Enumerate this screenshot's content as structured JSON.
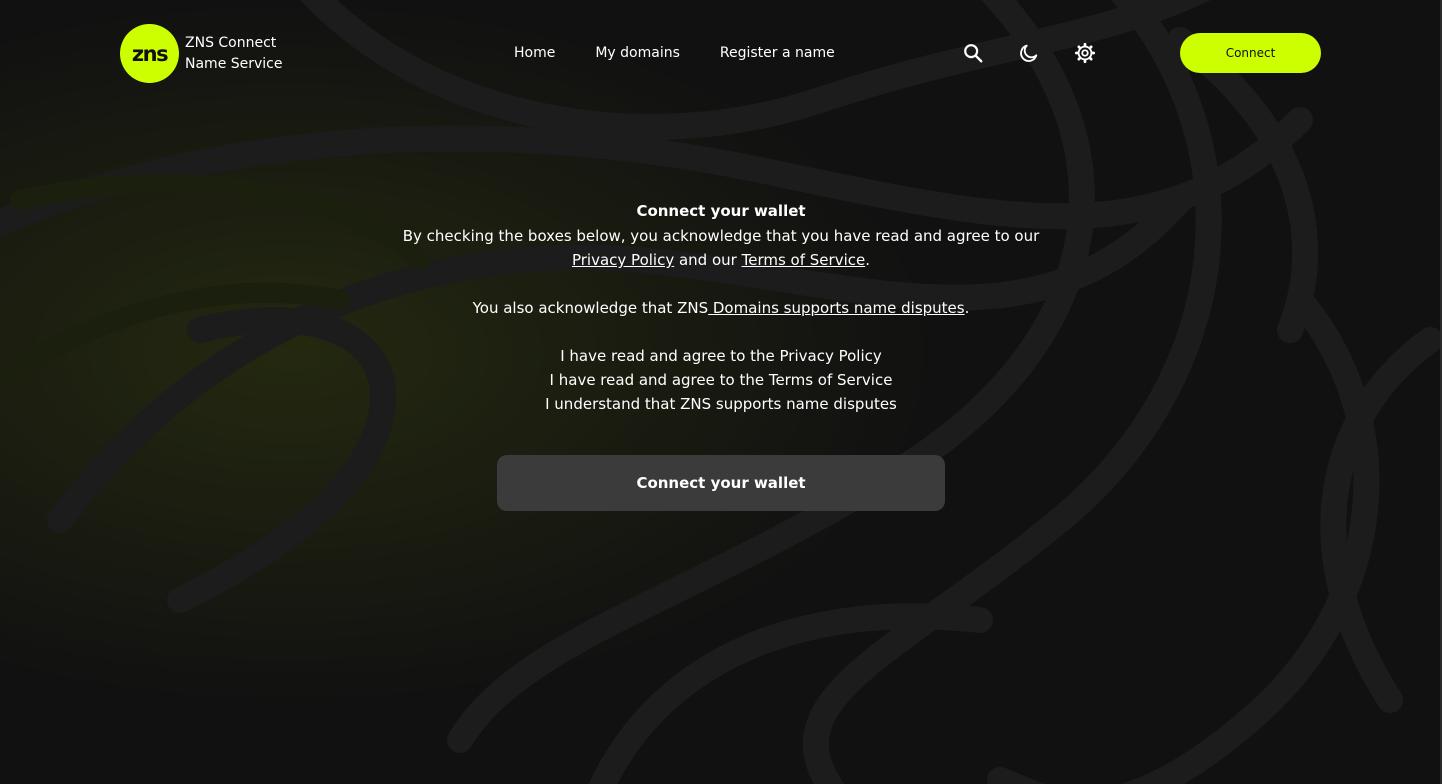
{
  "colors": {
    "accent": "#CCFF00",
    "background": "#111111",
    "wallet_button_bg": "#3b3b3b"
  },
  "header": {
    "logo": {
      "mark": "zns",
      "line1": "ZNS Connect",
      "line2": "Name Service"
    },
    "nav": [
      "Home",
      "My domains",
      "Register a name"
    ],
    "icons": [
      "search-icon",
      "moon-icon",
      "gear-icon"
    ],
    "connect_label": "Connect"
  },
  "main": {
    "title": "Connect your wallet",
    "intro_before": "By checking the boxes below, you acknowledge that you have read and agree to our",
    "privacy_link": "Privacy Policy",
    "intro_mid": " and our ",
    "terms_link": "Terms of Service",
    "intro_end": ".",
    "dispute_before": "You also acknowledge that ZNS",
    "dispute_link": " Domains supports name disputes",
    "dispute_end": ".",
    "checkboxes": [
      "I have read and agree to the Privacy Policy",
      "I have read and agree to the Terms of Service",
      "I understand that ZNS supports name disputes"
    ],
    "wallet_button_label": "Connect your wallet"
  }
}
